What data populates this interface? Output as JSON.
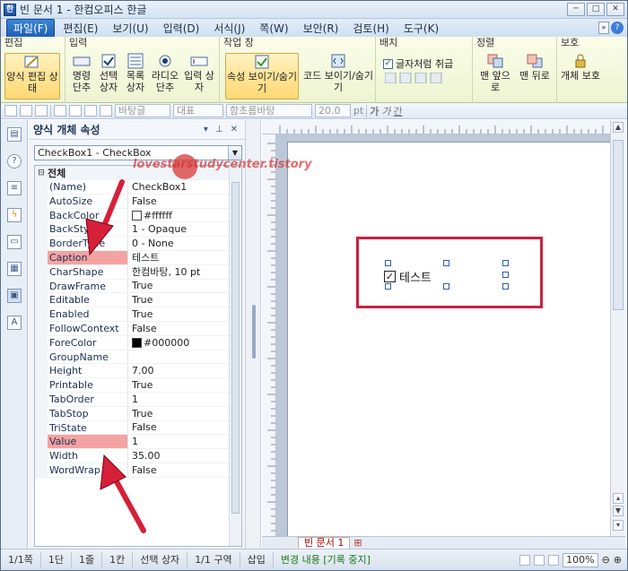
{
  "window": {
    "title": "빈 문서 1 - 한컴오피스 한글",
    "icon": "hwp-app-icon"
  },
  "menu": {
    "items": [
      "파일(F)",
      "편집(E)",
      "보기(U)",
      "입력(D)",
      "서식(J)",
      "쪽(W)",
      "보안(R)",
      "검토(H)",
      "도구(K)"
    ],
    "more": "»"
  },
  "ribbon": {
    "groups": {
      "edit": "편집",
      "input": "입력",
      "workwin": "작업 창",
      "arrange": "배치",
      "align": "정렬",
      "protect": "보호"
    },
    "buttons": {
      "form_edit": "양식 편집 상태",
      "name_cell": "명령 단추",
      "select_box": "선택 상자",
      "list_box": "목록 상자",
      "radio": "라디오 단추",
      "input_box": "입력 상자",
      "props": "속성 보이기/숨기기",
      "code": "코드 보이기/숨기기",
      "treat_as_char": "글자처럼 취급",
      "front": "맨 앞으로",
      "back": "맨 뒤로",
      "obj_protect": "개체 보호"
    }
  },
  "toolbar": {
    "style": "바탕글",
    "outline": "대표",
    "font": "함초롬바탕",
    "size": "20.0",
    "size_unit": "pt",
    "bold": "가",
    "italic": "가",
    "underline": "간"
  },
  "pane": {
    "title": "양식 개체 속성",
    "combo": "CheckBox1 - CheckBox",
    "category": "전체",
    "rows": [
      {
        "name": "(Name)",
        "value": "CheckBox1"
      },
      {
        "name": "AutoSize",
        "value": "False"
      },
      {
        "name": "BackColor",
        "value": "#ffffff"
      },
      {
        "name": "BackStyle",
        "value": "1 - Opaque"
      },
      {
        "name": "BorderType",
        "value": "0 - None"
      },
      {
        "name": "Caption",
        "value": "테스트"
      },
      {
        "name": "CharShape",
        "value": "한컴바탕, 10 pt"
      },
      {
        "name": "DrawFrame",
        "value": "True"
      },
      {
        "name": "Editable",
        "value": "True"
      },
      {
        "name": "Enabled",
        "value": "True"
      },
      {
        "name": "FollowContext",
        "value": "False"
      },
      {
        "name": "ForeColor",
        "value": "#000000"
      },
      {
        "name": "GroupName",
        "value": ""
      },
      {
        "name": "Height",
        "value": "7.00"
      },
      {
        "name": "Printable",
        "value": "True"
      },
      {
        "name": "TabOrder",
        "value": "1"
      },
      {
        "name": "TabStop",
        "value": "True"
      },
      {
        "name": "TriState",
        "value": "False"
      },
      {
        "name": "Value",
        "value": "1"
      },
      {
        "name": "Width",
        "value": "35.00"
      },
      {
        "name": "WordWrap",
        "value": "False"
      }
    ]
  },
  "document": {
    "checkbox_caption": "테스트",
    "tab_label": "빈 문서 1"
  },
  "status": {
    "page": "1/1쪽",
    "section": "1단",
    "line": "1줄",
    "col": "1칸",
    "obj": "선택 상자",
    "zone": "1/1 구역",
    "mode": "삽입",
    "track": "변경 내용 [기록 중지]",
    "zoom": "100%"
  },
  "watermark": "lovestarstudycenter.tistory",
  "colors": {
    "highlight": "#f4a3a3",
    "annotation_red": "#d6203a",
    "menu_active": "#1f5fb4",
    "ribbon_bg": "#eef4d2"
  }
}
